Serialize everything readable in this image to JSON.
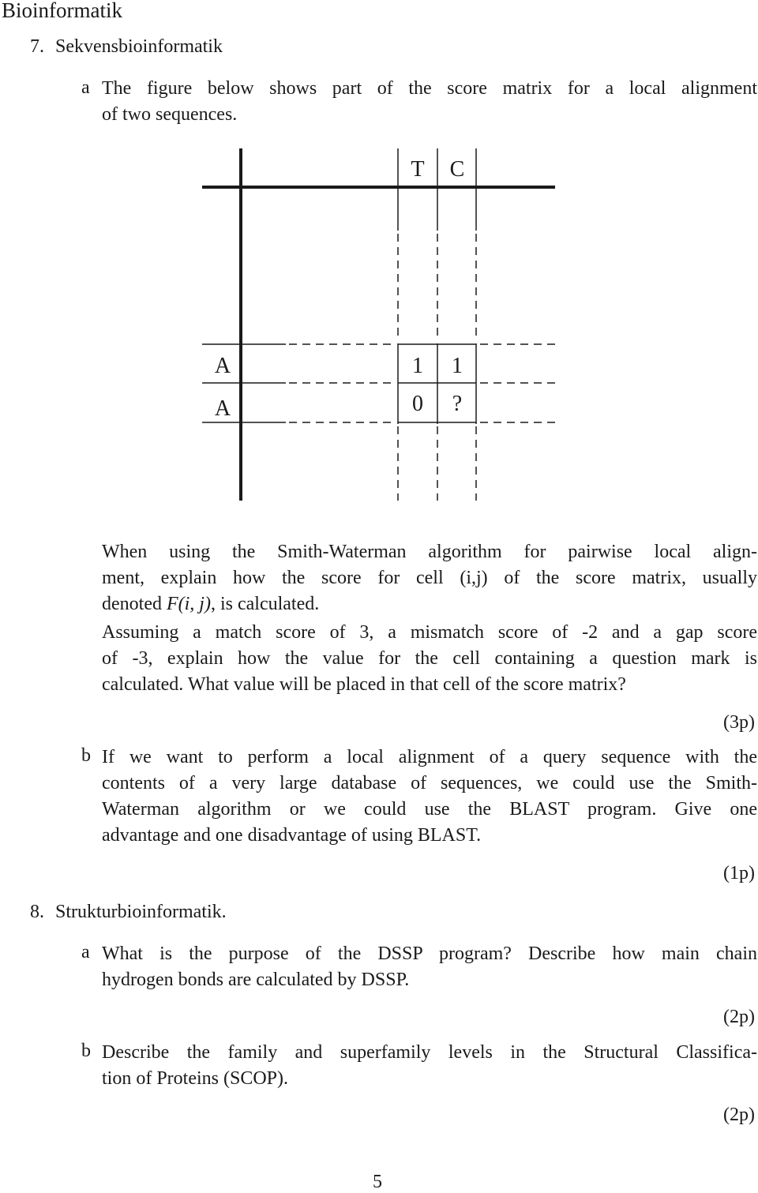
{
  "header": {
    "title": "Bioinformatik"
  },
  "sections": [
    {
      "number": "7.",
      "title": "Sekvensbioinformatik",
      "items": [
        {
          "label": "a",
          "intro_lines": [
            "The figure below shows part of the score matrix for a local alignment",
            "of two sequences."
          ],
          "figure": {
            "col_headers": [
              "T",
              "C"
            ],
            "row_headers": [
              "A",
              "A"
            ],
            "cells": [
              [
                "1",
                "1"
              ],
              [
                "0",
                "?"
              ]
            ]
          },
          "para1_lines": [
            "When using the Smith-Waterman algorithm for pairwise local align-",
            "ment, explain how the score for cell (i,j) of the score matrix, usually"
          ],
          "para1_last_prefix": "denoted ",
          "para1_math": "F(i, j)",
          "para1_last_suffix": ", is calculated.",
          "para2_lines": [
            "Assuming a match score of 3, a mismatch score of -2 and a gap score",
            "of -3, explain how the value for the cell containing a question mark is",
            "calculated. What value will be placed in that cell of the score matrix?"
          ],
          "points": "(3p)"
        },
        {
          "label": "b",
          "lines": [
            "If we want to perform a local alignment of a query sequence with the",
            "contents of a very large database of sequences, we could use the Smith-",
            "Waterman algorithm or we could use the BLAST program. Give one",
            "advantage and one disadvantage of using BLAST."
          ],
          "points": "(1p)"
        }
      ]
    },
    {
      "number": "8.",
      "title": "Strukturbioinformatik.",
      "items": [
        {
          "label": "a",
          "lines": [
            "What is the purpose of the DSSP program? Describe how main chain",
            "hydrogen bonds are calculated by DSSP."
          ],
          "points": "(2p)"
        },
        {
          "label": "b",
          "lines": [
            "Describe the family and superfamily levels in the Structural Classifica-",
            "tion of Proteins (SCOP)."
          ],
          "points": "(2p)"
        }
      ]
    }
  ],
  "footer": {
    "page_number": "5"
  }
}
